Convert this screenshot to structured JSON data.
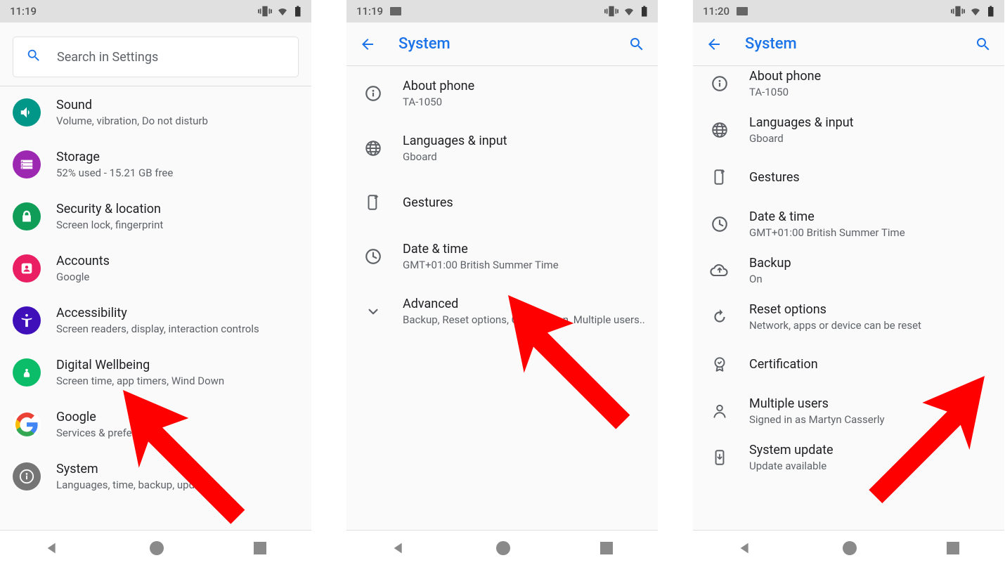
{
  "screens": [
    {
      "status": {
        "time": "11:19",
        "has_gallery_icon": false
      },
      "search_placeholder": "Search in Settings",
      "items": [
        {
          "title": "Sound",
          "sub": "Volume, vibration, Do not disturb"
        },
        {
          "title": "Storage",
          "sub": "52% used - 15.21 GB free"
        },
        {
          "title": "Security & location",
          "sub": "Screen lock, fingerprint"
        },
        {
          "title": "Accounts",
          "sub": "Google"
        },
        {
          "title": "Accessibility",
          "sub": "Screen readers, display, interaction controls"
        },
        {
          "title": "Digital Wellbeing",
          "sub": "Screen time, app timers, Wind Down"
        },
        {
          "title": "Google",
          "sub": "Services & preferences"
        },
        {
          "title": "System",
          "sub": "Languages, time, backup, updates"
        }
      ]
    },
    {
      "status": {
        "time": "11:19",
        "has_gallery_icon": true
      },
      "header": "System",
      "items": [
        {
          "title": "About phone",
          "sub": "TA-1050"
        },
        {
          "title": "Languages & input",
          "sub": "Gboard"
        },
        {
          "title": "Gestures",
          "sub": ""
        },
        {
          "title": "Date & time",
          "sub": "GMT+01:00 British Summer Time"
        },
        {
          "title": "Advanced",
          "sub": "Backup, Reset options, Certification, Multiple users.."
        }
      ]
    },
    {
      "status": {
        "time": "11:20",
        "has_gallery_icon": true
      },
      "header": "System",
      "items": [
        {
          "title": "About phone",
          "sub": "TA-1050"
        },
        {
          "title": "Languages & input",
          "sub": "Gboard"
        },
        {
          "title": "Gestures",
          "sub": ""
        },
        {
          "title": "Date & time",
          "sub": "GMT+01:00 British Summer Time"
        },
        {
          "title": "Backup",
          "sub": "On"
        },
        {
          "title": "Reset options",
          "sub": "Network, apps or device can be reset"
        },
        {
          "title": "Certification",
          "sub": ""
        },
        {
          "title": "Multiple users",
          "sub": "Signed in as Martyn Casserly"
        },
        {
          "title": "System update",
          "sub": "Update available"
        }
      ]
    }
  ]
}
